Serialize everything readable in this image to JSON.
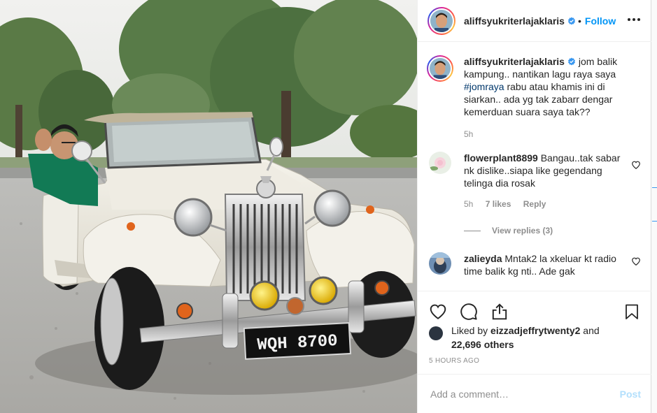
{
  "header": {
    "username": "aliffsyukriterlajaklaris",
    "dot": "•",
    "follow_label": "Follow"
  },
  "caption": {
    "username": "aliffsyukriterlajaklaris",
    "text_before": " jom balik kampung.. nantikan lagu raya saya ",
    "hashtag": "#jomraya",
    "text_after": " rabu atau khamis ini di siarkan.. ada yg tak zabarr dengar kemerduan suara saya tak??",
    "time": "5h"
  },
  "comments": [
    {
      "username": "flowerplant8899",
      "text": " Bangau..tak sabar nk dislike..siapa like gegendang telinga dia rosak",
      "time": "5h",
      "likes": "7 likes",
      "reply": "Reply",
      "view_replies": "View replies (3)"
    },
    {
      "username": "zalieyda",
      "text": " Mntak2 la xkeluar kt radio time balik kg nti.. Ade gak"
    }
  ],
  "likes": {
    "prefix": "Liked by ",
    "user": "eizzadjeffrytwenty2",
    "middle": " and",
    "count": "22,696 others"
  },
  "timestamp": "5 HOURS AGO",
  "comment_box": {
    "placeholder": "Add a comment…",
    "post_label": "Post"
  },
  "photo": {
    "plate": "WQH 8700"
  },
  "colors": {
    "accent": "#0095f6",
    "post_disabled": "#b2dffc",
    "muted": "#8e8e8e"
  },
  "icons": [
    "verified-badge-icon",
    "more-options-icon",
    "heart-icon",
    "comment-icon",
    "share-icon",
    "bookmark-icon"
  ]
}
